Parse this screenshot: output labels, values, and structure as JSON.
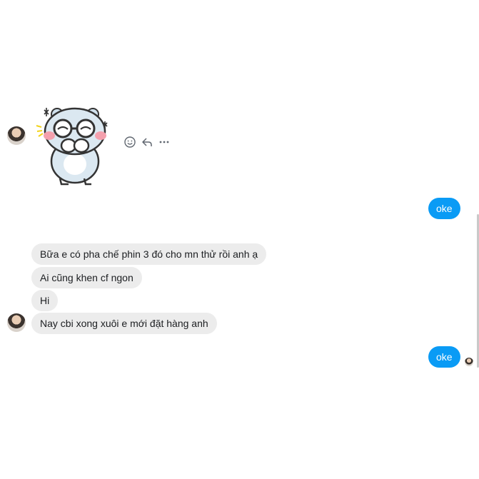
{
  "thread": {
    "incoming": [
      "Bữa e có pha chế phin 3 đó cho mn thử rồi anh ạ",
      "Ai cũng khen cf ngon",
      "Hi",
      "Nay cbi xong xuôi e mới đặt hàng anh"
    ],
    "outgoing": [
      "oke",
      "oke"
    ]
  },
  "colors": {
    "outgoing_bubble": "#0a9bf5",
    "incoming_bubble": "#ececec",
    "background": "#ffffff"
  },
  "icons": {
    "react": "smiley-icon",
    "reply": "reply-icon",
    "more": "more-icon",
    "sticker": "bear-sticker"
  }
}
